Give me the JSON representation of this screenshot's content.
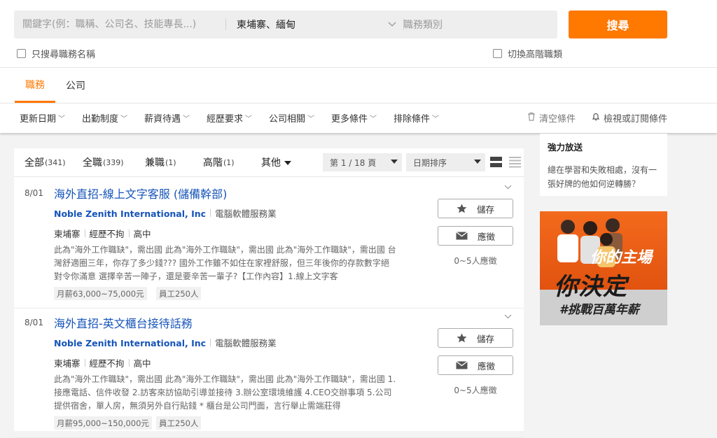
{
  "search": {
    "keyword_placeholder": "關鍵字(例：職稱、公司名、技能專長...)",
    "keyword_value": "",
    "area": "柬埔寨、緬甸",
    "category_placeholder": "職務類別",
    "button": "搜尋",
    "only_title": "只搜尋職務名稱",
    "switch_senior": "切換高階職類"
  },
  "tabs": [
    "職務",
    "公司"
  ],
  "filters": [
    "更新日期",
    "出勤制度",
    "薪資待遇",
    "經歷要求",
    "公司相關",
    "更多條件",
    "排除條件"
  ],
  "filter_actions": {
    "clear": "清空條件",
    "subscribe": "檢視或訂閱條件"
  },
  "list_tabs": [
    {
      "label": "全部",
      "count": "(341)"
    },
    {
      "label": "全職",
      "count": "(339)"
    },
    {
      "label": "兼職",
      "count": "(1)"
    },
    {
      "label": "高階",
      "count": "(1)"
    },
    {
      "label": "其他",
      "count": ""
    }
  ],
  "pager": "第 1 / 18 頁",
  "sort": "日期排序",
  "jobs": [
    {
      "date": "8/01",
      "title": "海外直招-線上文字客服 (儲備幹部)",
      "company": "Noble Zenith International, Inc",
      "industry": "電腦軟體服務業",
      "location": "柬埔寨",
      "experience": "經歷不拘",
      "education": "高中",
      "desc": "此為\"海外工作職缺\"，需出國 此為\"海外工作職缺\"，需出國 此為\"海外工作職缺\"，需出國 台灣舒適圈三年，你存了多少錢??? 國外工作雖不如住在家裡舒服，但三年後你的存款數字絕對令你滿意 選擇辛苦一陣子，還是要辛苦一輩子?【工作內容】1.線上文字客",
      "salary": "月薪63,000~75,000元",
      "staff": "員工250人",
      "save": "儲存",
      "apply": "應徵",
      "applicants": "0~5人應徵"
    },
    {
      "date": "8/01",
      "title": "海外直招-英文櫃台接待話務",
      "company": "Noble Zenith International, Inc",
      "industry": "電腦軟體服務業",
      "location": "柬埔寨",
      "experience": "經歷不拘",
      "education": "高中",
      "desc": "此為\"海外工作職缺\"，需出國 此為\"海外工作職缺\"，需出國 此為\"海外工作職缺\"，需出國 1.接應電話、信件收發 2.訪客來訪協助引導並接待 3.辦公室環境維護 4.CEO交辦事項 5.公司提供宿舍，單人房，無須另外自行貼錢 * 櫃台是公司門面，言行舉止需端莊得",
      "salary": "月薪95,000~150,000元",
      "staff": "員工250人",
      "save": "儲存",
      "apply": "應徵",
      "applicants": "0~5人應徵"
    }
  ],
  "sidebar": {
    "promo_title": "強力放送",
    "promo_text": "總在學習和失敗相處，沒有一張好牌的他如何逆轉勝？",
    "ad_line1": "你的主場",
    "ad_line2": "你決定",
    "ad_line3": "#挑戰百萬年薪"
  },
  "colors": {
    "accent": "#ff7800",
    "link": "#1654b9"
  }
}
